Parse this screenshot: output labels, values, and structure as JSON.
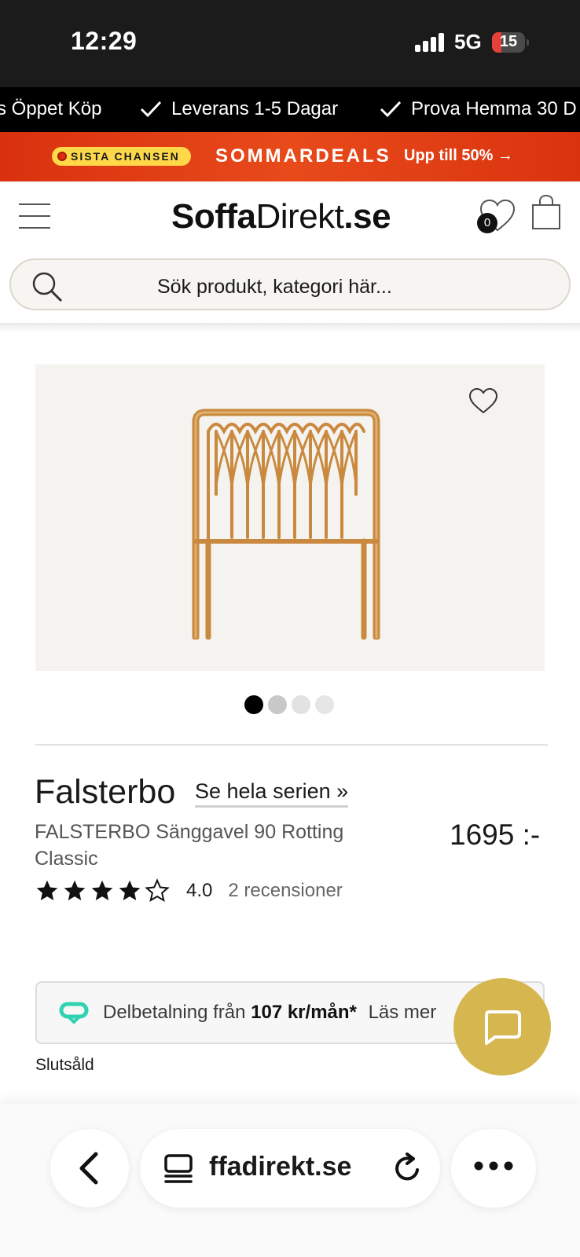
{
  "status_bar": {
    "time": "12:29",
    "network": "5G",
    "battery": "15"
  },
  "usp_bar": {
    "items": [
      {
        "label": "s Öppet Köp"
      },
      {
        "label": "Leverans 1-5 Dagar"
      },
      {
        "label": "Prova Hemma 30 D"
      }
    ]
  },
  "promo": {
    "badge": "SISTA CHANSEN",
    "title": "SOMMARDEALS",
    "cta": "Upp till 50% →"
  },
  "header": {
    "logo_bold": "Soffa",
    "logo_light": "Direkt",
    "logo_suffix": ".se",
    "wishlist_count": "0",
    "search_placeholder": "Sök produkt, kategori här..."
  },
  "gallery": {
    "image_count": 4,
    "active_index": 0
  },
  "product": {
    "series": "Falsterbo",
    "series_link": "Se hela serien »",
    "name": "FALSTERBO Sänggavel 90 Rotting Classic",
    "price": "1695 :-",
    "rating_value": "4.0",
    "rating_stars": 4,
    "rating_count": "2 recensioner",
    "availability": "Slutsåld"
  },
  "payment": {
    "text_prefix": "Delbetalning från",
    "amount": "107 kr/mån*",
    "link": "Läs mer"
  },
  "browser": {
    "url": "ffadirekt.se"
  },
  "colors": {
    "promo_red": "#e03a14",
    "badge_yellow": "#ffd84a",
    "chat_gold": "#d6b74f",
    "klarna_teal": "#2fd3b0"
  }
}
